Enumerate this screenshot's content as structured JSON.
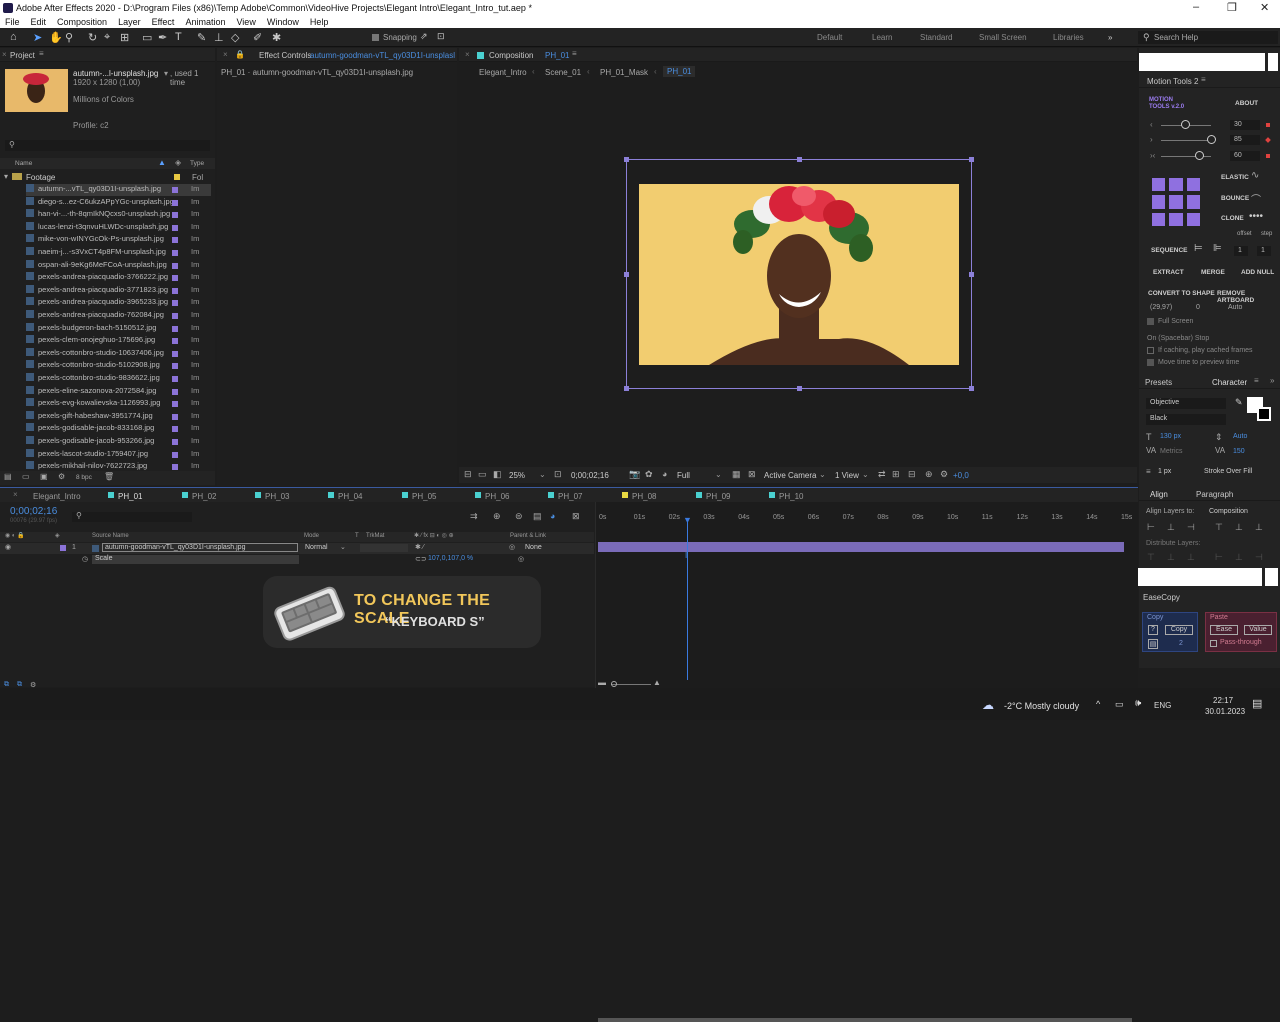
{
  "window": {
    "title": "Adobe After Effects 2020 - D:\\Program Files (x86)\\Temp Adobe\\Common\\VideoHive Projects\\Elegant Intro\\Elegant_Intro_tut.aep *",
    "controls": [
      "–",
      "❐",
      "✕"
    ]
  },
  "menu": [
    "File",
    "Edit",
    "Composition",
    "Layer",
    "Effect",
    "Animation",
    "View",
    "Window",
    "Help"
  ],
  "toolbar": {
    "snapping": "Snapping",
    "workspaces": [
      "Default",
      "Learn",
      "Standard",
      "Small Screen",
      "Libraries"
    ],
    "search_placeholder": "Search Help"
  },
  "project": {
    "tab": "Project",
    "asset_name": "autumn-...l-unsplash.jpg",
    "asset_used": ", used 1 time",
    "asset_dims": "1920 x 1280 (1,00)",
    "asset_colors": "Millions of Colors",
    "asset_profile": "Profile: c2",
    "col_name": "Name",
    "col_type": "Type",
    "folder": "Footage",
    "folder_type": "Fol",
    "bpc": "8 bpc",
    "files": [
      "autumn-...vTL_qy03D1I-unsplash.jpg",
      "diego-s...ez-C6ukzAPpYGc-unsplash.jpg",
      "han-vi-...-th-8qmIkNQcxs0-unsplash.jpg",
      "lucas-lenzi-t3qnvuHLWDc-unsplash.jpg",
      "mike-von-wINYGcOk-Ps-unsplash.jpg",
      "naeim-j...-s3VxCT4p8FM-unsplash.jpg",
      "ospan-ali-9eKg6MeFCoA-unsplash.jpg",
      "pexels-andrea-piacquadio-3766222.jpg",
      "pexels-andrea-piacquadio-3771823.jpg",
      "pexels-andrea-piacquadio-3965233.jpg",
      "pexels-andrea-piacquadio-762084.jpg",
      "pexels-budgeron-bach-5150512.jpg",
      "pexels-clem-onojeghuo-175696.jpg",
      "pexels-cottonbro-studio-10637406.jpg",
      "pexels-cottonbro-studio-5102908.jpg",
      "pexels-cottonbro-studio-9836622.jpg",
      "pexels-eline-sazonova-2072584.jpg",
      "pexels-evg-kowalievska-1126993.jpg",
      "pexels-gift-habeshaw-3951774.jpg",
      "pexels-godisable-jacob-833168.jpg",
      "pexels-godisable-jacob-953266.jpg",
      "pexels-lascot-studio-1759407.jpg",
      "pexels-mikhail-nilov-7622723.jpg"
    ],
    "file_type": "Im"
  },
  "effect_controls": {
    "tab": "Effect Controls",
    "tab_file": "autumn-goodman-vTL_qy03D1I-unsplasl",
    "sub": "PH_01 · autumn-goodman-vTL_qy03D1I-unsplash.jpg"
  },
  "composition": {
    "tab": "Composition",
    "tab_name": "PH_01",
    "breadcrumbs": [
      "Elegant_Intro",
      "Scene_01",
      "PH_01_Mask",
      "PH_01"
    ],
    "zoom": "25%",
    "timecode": "0;00;02;16",
    "resolution": "Full",
    "camera": "Active Camera",
    "view": "1 View",
    "exposure": "+0,0"
  },
  "motion_tools": {
    "tab": "Motion Tools 2",
    "logo": "MOTION TOOLS v.2.0",
    "about": "ABOUT",
    "values": [
      "30",
      "85",
      "60"
    ],
    "elastic": "ELASTIC",
    "bounce": "BOUNCE",
    "clone": "CLONE",
    "offset": "offset",
    "step": "step",
    "sequence": "SEQUENCE",
    "seq_vals": [
      "1",
      "1"
    ],
    "extract": "EXTRACT",
    "merge": "MERGE",
    "add_null": "ADD NULL",
    "convert": "CONVERT TO SHAPE",
    "remove": "REMOVE ARTBOARD"
  },
  "preview": {
    "fps": "(29,97)",
    "skip": "0",
    "res": "Auto",
    "full_screen": "Full Screen",
    "on_stop": "On (Spacebar) Stop",
    "if_caching": "If caching, play cached frames",
    "move_time": "Move time to preview time"
  },
  "character": {
    "tab_presets": "Presets",
    "tab": "Character",
    "font": "Objective",
    "style": "Black",
    "size": "130 px",
    "leading": "Auto",
    "kerning": "Metrics",
    "tracking": "150",
    "stroke": "1 px",
    "stroke_type": "Stroke Over Fill"
  },
  "align": {
    "tab": "Align",
    "tab2": "Paragraph",
    "align_to_label": "Align Layers to:",
    "align_to": "Composition",
    "distribute": "Distribute Layers:"
  },
  "easecopy": {
    "tab": "EaseCopy",
    "copy_label": "Copy",
    "copy_btn": "Copy",
    "copy_num": "2",
    "paste_label": "Paste",
    "ease_btn": "Ease",
    "value_btn": "Value",
    "pass_through": "Pass-through"
  },
  "timeline": {
    "tabs": [
      "Elegant_Intro",
      "PH_01",
      "PH_02",
      "PH_03",
      "PH_04",
      "PH_05",
      "PH_06",
      "PH_07",
      "PH_08",
      "PH_09",
      "PH_10"
    ],
    "timecode": "0;00;02;16",
    "frames": "00076 (29.97 fps)",
    "col_source": "Source Name",
    "col_mode": "Mode",
    "col_t": "T",
    "col_trkmat": "TrkMat",
    "col_parent": "Parent & Link",
    "layer_num": "1",
    "layer_name": "autumn-goodman-vTL_qy03D1I-unsplash.jpg",
    "layer_mode": "Normal",
    "layer_parent": "None",
    "prop_name": "Scale",
    "prop_value": "107,0,107,0 %",
    "ruler": [
      "0s",
      "01s",
      "02s",
      "03s",
      "04s",
      "05s",
      "06s",
      "07s",
      "08s",
      "09s",
      "10s",
      "11s",
      "12s",
      "13s",
      "14s",
      "15s"
    ]
  },
  "overlay": {
    "line1": "TO CHANGE THE SCALE",
    "line2": "“KEYBOARD S”"
  },
  "taskbar": {
    "weather": "-2°C  Mostly cloudy",
    "lang": "ENG",
    "time": "22:17",
    "date": "30.01.2023"
  }
}
